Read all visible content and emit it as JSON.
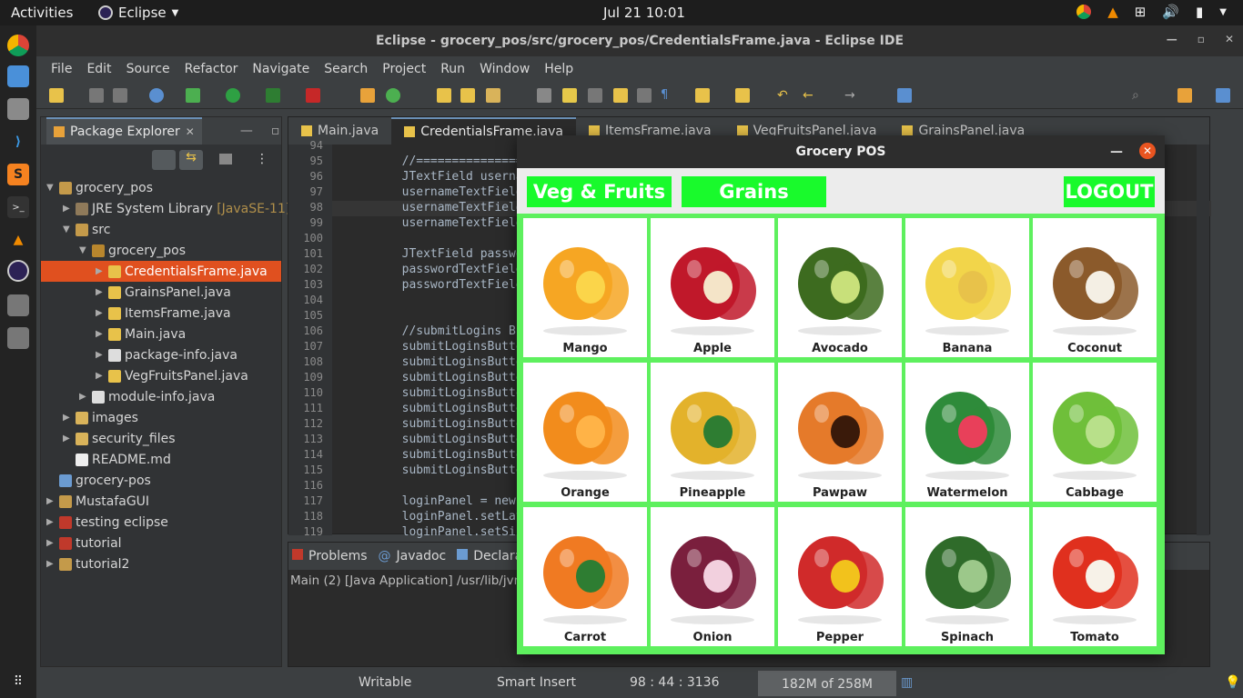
{
  "topbar": {
    "activities": "Activities",
    "app": "Eclipse",
    "clock": "Jul 21  10:01"
  },
  "window": {
    "title": "Eclipse - grocery_pos/src/grocery_pos/CredentialsFrame.java - Eclipse IDE"
  },
  "menu": [
    "File",
    "Edit",
    "Source",
    "Refactor",
    "Navigate",
    "Search",
    "Project",
    "Run",
    "Window",
    "Help"
  ],
  "explorer": {
    "title": "Package Explorer",
    "items": [
      {
        "label": "grocery_pos",
        "extra": ""
      },
      {
        "label": "JRE System Library",
        "extra": "[JavaSE-11]"
      },
      {
        "label": "src",
        "extra": ""
      },
      {
        "label": "grocery_pos",
        "extra": ""
      },
      {
        "label": "CredentialsFrame.java",
        "extra": ""
      },
      {
        "label": "GrainsPanel.java",
        "extra": ""
      },
      {
        "label": "ItemsFrame.java",
        "extra": ""
      },
      {
        "label": "Main.java",
        "extra": ""
      },
      {
        "label": "package-info.java",
        "extra": ""
      },
      {
        "label": "VegFruitsPanel.java",
        "extra": ""
      },
      {
        "label": "module-info.java",
        "extra": ""
      },
      {
        "label": "images",
        "extra": ""
      },
      {
        "label": "security_files",
        "extra": ""
      },
      {
        "label": "README.md",
        "extra": ""
      },
      {
        "label": "grocery-pos",
        "extra": ""
      },
      {
        "label": "MustafaGUI",
        "extra": ""
      },
      {
        "label": "testing eclipse",
        "extra": ""
      },
      {
        "label": "tutorial",
        "extra": ""
      },
      {
        "label": "tutorial2",
        "extra": ""
      }
    ]
  },
  "editor": {
    "tabs": [
      "Main.java",
      "CredentialsFrame.java",
      "ItemsFrame.java",
      "VegFruitsPanel.java",
      "GrainsPanel.java"
    ],
    "lines": [
      {
        "n": "94",
        "t": ""
      },
      {
        "n": "95",
        "t": "        //======================"
      },
      {
        "n": "96",
        "t": "        JTextField usernam"
      },
      {
        "n": "97",
        "t": "        usernameTextField"
      },
      {
        "n": "98",
        "t": "        usernameTextField"
      },
      {
        "n": "99",
        "t": "        usernameTextField"
      },
      {
        "n": "100",
        "t": ""
      },
      {
        "n": "101",
        "t": "        JTextField passwo"
      },
      {
        "n": "102",
        "t": "        passwordTextField"
      },
      {
        "n": "103",
        "t": "        passwordTextField"
      },
      {
        "n": "104",
        "t": ""
      },
      {
        "n": "105",
        "t": ""
      },
      {
        "n": "106",
        "t": "        //submitLogins Bu"
      },
      {
        "n": "107",
        "t": "        submitLoginsButton"
      },
      {
        "n": "108",
        "t": "        submitLoginsButton"
      },
      {
        "n": "109",
        "t": "        submitLoginsButton"
      },
      {
        "n": "110",
        "t": "        submitLoginsButton"
      },
      {
        "n": "111",
        "t": "        submitLoginsButton"
      },
      {
        "n": "112",
        "t": "        submitLoginsButton"
      },
      {
        "n": "113",
        "t": "        submitLoginsButton"
      },
      {
        "n": "114",
        "t": "        submitLoginsButton"
      },
      {
        "n": "115",
        "t": "        submitLoginsButton"
      },
      {
        "n": "116",
        "t": ""
      },
      {
        "n": "117",
        "t": "        loginPanel = new J"
      },
      {
        "n": "118",
        "t": "        loginPanel.setLay"
      },
      {
        "n": "119",
        "t": "        loginPanel.setSiz"
      }
    ]
  },
  "console": {
    "tabs": [
      "Problems",
      "Javadoc",
      "Declara"
    ],
    "line": "Main (2) [Java Application] /usr/lib/jvm"
  },
  "status": {
    "writable": "Writable",
    "insert": "Smart Insert",
    "position": "98 : 44 : 3136",
    "heap": "182M of 258M"
  },
  "pos": {
    "title": "Grocery POS",
    "buttons": {
      "veg": "Veg & Fruits",
      "grains": "Grains",
      "logout": "LOGOUT"
    },
    "items": [
      "Mango",
      "Apple",
      "Avocado",
      "Banana",
      "Coconut",
      "Orange",
      "Pineapple",
      "Pawpaw",
      "Watermelon",
      "Cabbage",
      "Carrot",
      "Onion",
      "Pepper",
      "Spinach",
      "Tomato"
    ],
    "accent": "#19fa2c"
  }
}
